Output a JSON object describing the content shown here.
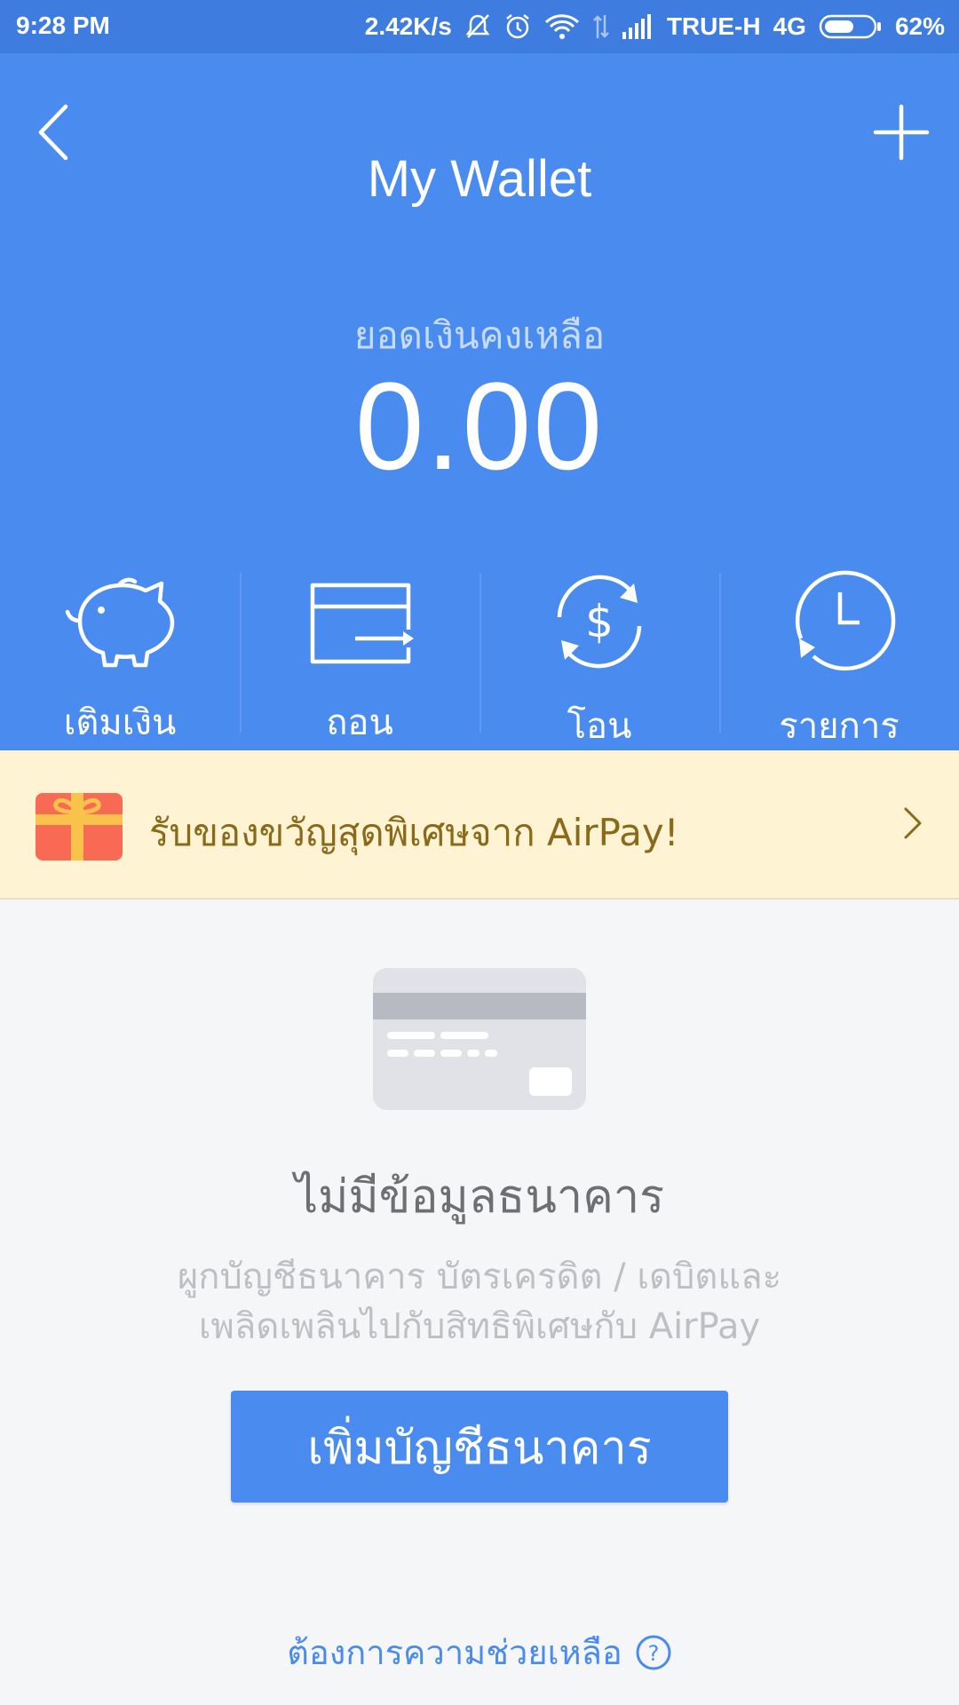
{
  "status_bar": {
    "time": "9:28 PM",
    "net_speed": "2.42K/s",
    "carrier": "TRUE-H",
    "network": "4G",
    "battery": "62%",
    "battery_level_percent": 62
  },
  "header": {
    "title": "My Wallet",
    "back_icon": "chevron-left-icon",
    "add_icon": "plus-icon"
  },
  "balance": {
    "label": "ยอดเงินคงเหลือ",
    "amount": "0.00"
  },
  "actions": [
    {
      "label": "เติมเงิน",
      "icon": "piggy-bank-icon"
    },
    {
      "label": "ถอน",
      "icon": "withdraw-icon"
    },
    {
      "label": "โอน",
      "icon": "transfer-icon"
    },
    {
      "label": "รายการ",
      "icon": "clock-icon"
    }
  ],
  "promo": {
    "text": "รับของขวัญสุดพิเศษจาก AirPay!",
    "icon": "gift-icon"
  },
  "empty_state": {
    "title": "ไม่มีข้อมูลธนาคาร",
    "description_line1": "ผูกบัญชีธนาคาร บัตรเครดิต / เดบิตและ",
    "description_line2": "เพลิดเพลินไปกับสิทธิพิเศษกับ AirPay",
    "button_label": "เพิ่มบัญชีธนาคาร"
  },
  "help": {
    "label": "ต้องการความช่วยเหลือ"
  },
  "colors": {
    "primary": "#4A8BEF",
    "status_bar": "#3F7CE0",
    "promo_bg": "#FEF4D4",
    "promo_text": "#8A6A1A",
    "gift": "#F96A55"
  }
}
